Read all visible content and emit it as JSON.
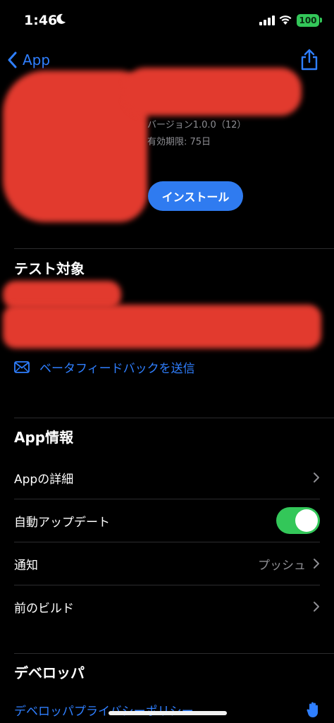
{
  "status_bar": {
    "time": "1:46",
    "battery": "100",
    "battery_color": "#33c759"
  },
  "nav": {
    "back_label": "App",
    "share_icon": "share-icon",
    "accent_color": "#2f7fff"
  },
  "app_header": {
    "version": "バージョン1.0.0（12）",
    "expiry": "有効期限: 75日",
    "install_label": "インストール",
    "redact_color": "#e23a2e"
  },
  "testing": {
    "title": "テスト対象",
    "feedback_label": "ベータフィードバックを送信"
  },
  "app_info": {
    "title": "App情報",
    "rows": [
      {
        "label": "Appの詳細",
        "value": ""
      },
      {
        "label": "自動アップデート",
        "toggle_on": true
      },
      {
        "label": "通知",
        "value": "プッシュ"
      },
      {
        "label": "前のビルド",
        "value": ""
      }
    ]
  },
  "developer": {
    "title": "デベロッパ",
    "privacy_link": "デベロッパプライバシーポリシー"
  }
}
